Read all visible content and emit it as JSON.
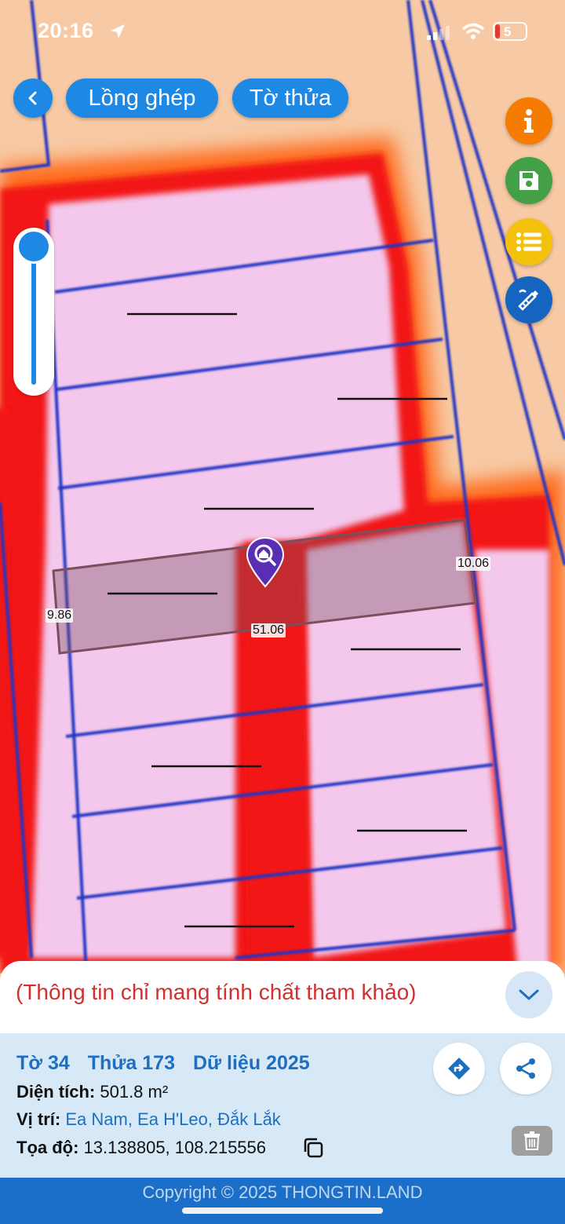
{
  "status_bar": {
    "time": "20:16",
    "battery_level": "5"
  },
  "toolbar": {
    "overlay_label": "Lồng ghép",
    "parcel_label": "Tờ thửa"
  },
  "side_actions": [
    "info-icon",
    "save-icon",
    "list-icon",
    "measure-tool-icon"
  ],
  "zoom_slider": {
    "level": 0.0
  },
  "map": {
    "dimension_labels": {
      "left": "9.86",
      "right": "10.06",
      "bottom": "51.06"
    },
    "colors": {
      "land": "#f7c9a4",
      "zone_pink": "#f3c8ec",
      "zone_border_red": "#f21212",
      "zone_halo_orange": "#ff6a1a",
      "parcel_line": "#2434c4",
      "selected_parcel": "#7a4f5e"
    }
  },
  "panel": {
    "disclaimer": "(Thông tin chỉ mang tính chất tham khảo)",
    "sheet": "Tờ 34",
    "parcel": "Thửa 173",
    "data_year": "Dữ liệu 2025",
    "area_label": "Diện tích:",
    "area_value": "501.8 m²",
    "location_label": "Vị trí:",
    "location_value": "Ea Nam, Ea H'Leo, Đắk Lắk",
    "coord_label": "Tọa độ:",
    "coord_value": "13.138805, 108.215556"
  },
  "footer": {
    "copyright": "Copyright © 2025 THONGTIN.LAND"
  }
}
